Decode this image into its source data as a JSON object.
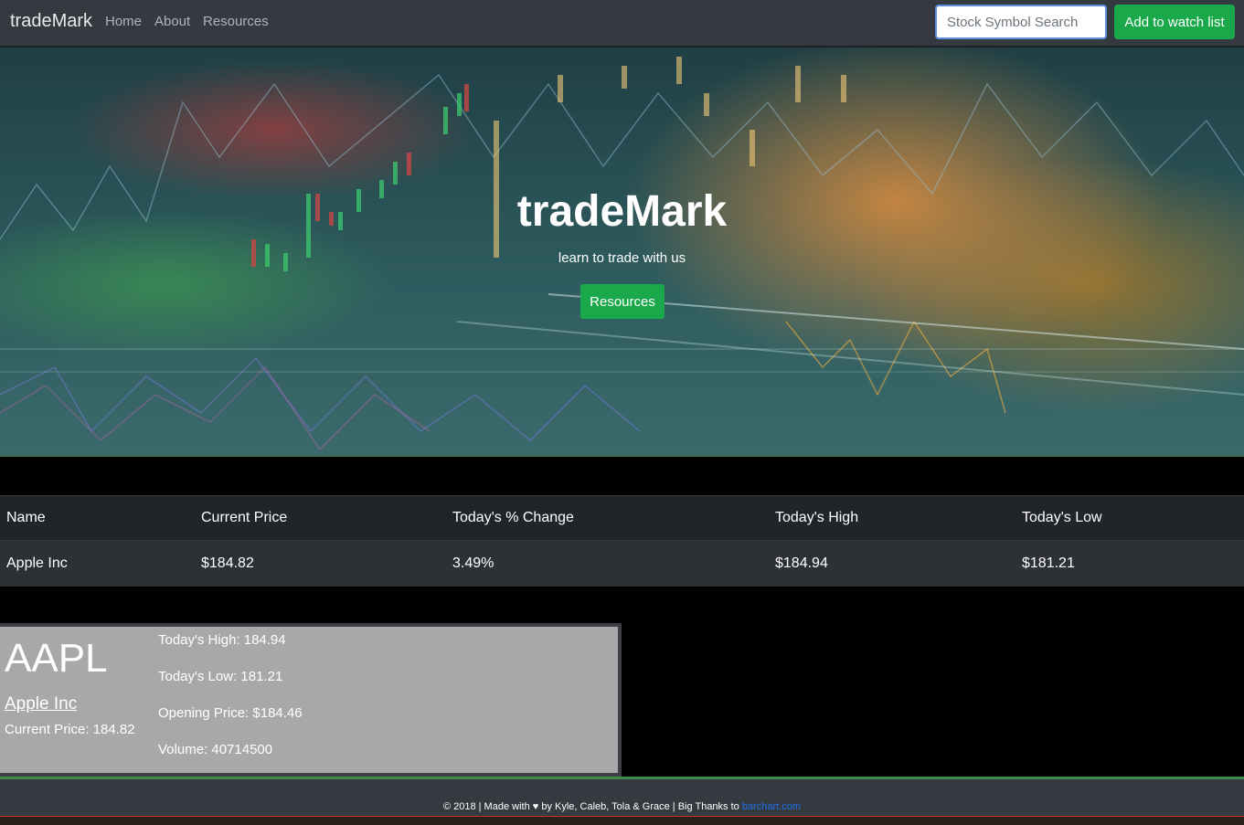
{
  "nav": {
    "brand": "tradeMark",
    "links": [
      "Home",
      "About",
      "Resources"
    ],
    "search_placeholder": "Stock Symbol Search",
    "watch_button": "Add to watch list"
  },
  "hero": {
    "title": "tradeMark",
    "subtitle": "learn to trade with us",
    "button": "Resources"
  },
  "table": {
    "headers": [
      "Name",
      "Current Price",
      "Today's % Change",
      "Today's High",
      "Today's Low"
    ],
    "rows": [
      [
        "Apple Inc",
        "$184.82",
        "3.49%",
        "$184.94",
        "$181.21"
      ]
    ]
  },
  "card": {
    "ticker": "AAPL",
    "company": "Apple Inc",
    "current_price": "Current Price: 184.82",
    "stats": [
      "Today's High: 184.94",
      "Today's Low: 181.21",
      "Opening Price: $184.46",
      "Volume: 40714500"
    ]
  },
  "footer": {
    "text": "© 2018 | Made with ♥ by Kyle, Caleb, Tola & Grace | Big Thanks to ",
    "link": "barchart.com"
  },
  "colors": {
    "navbar": "#343a40",
    "accent_green": "#1aa94a",
    "link_blue": "#1e6fe8",
    "card_gray": "#a8a8a8"
  }
}
